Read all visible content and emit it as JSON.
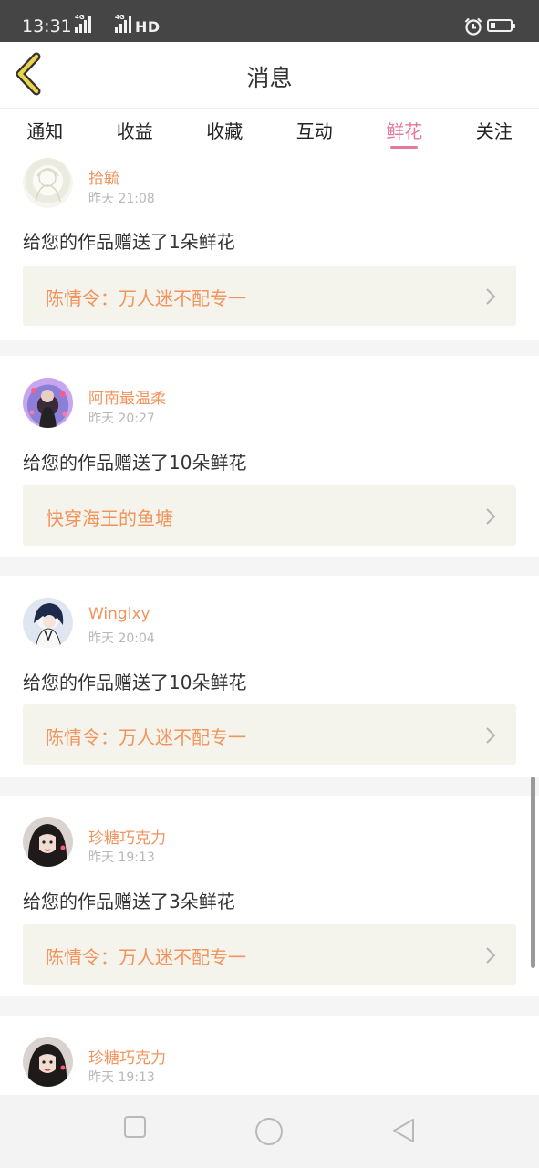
{
  "status_bar": {
    "time": "13:31",
    "signal_1": "4G",
    "signal_2": "4G",
    "hd_label": "HD",
    "battery_level": 0.25,
    "alarm_icon": "alarm-clock-icon"
  },
  "header": {
    "title": "消息",
    "back_icon": "chevron-left-icon"
  },
  "tabs": [
    {
      "label": "通知",
      "active": false
    },
    {
      "label": "收益",
      "active": false
    },
    {
      "label": "收藏",
      "active": false
    },
    {
      "label": "互动",
      "active": false
    },
    {
      "label": "鲜花",
      "active": true
    },
    {
      "label": "关注",
      "active": false
    }
  ],
  "feed": {
    "items": [
      {
        "user": "拾毓",
        "time": "昨天 21:08",
        "message": "给您的作品赠送了1朵鲜花",
        "work": "陈情令：万人迷不配专一"
      },
      {
        "user": "阿南最温柔",
        "time": "昨天 20:27",
        "message": "给您的作品赠送了10朵鲜花",
        "work": "快穿海王的鱼塘"
      },
      {
        "user": "Winglxy",
        "time": "昨天 20:04",
        "message": "给您的作品赠送了10朵鲜花",
        "work": "陈情令：万人迷不配专一"
      },
      {
        "user": "珍糖巧克力",
        "time": "昨天 19:13",
        "message": "给您的作品赠送了3朵鲜花",
        "work": "陈情令：万人迷不配专一"
      },
      {
        "user": "珍糖巧克力",
        "time": "昨天 19:13"
      }
    ]
  },
  "nav_bar": {
    "recents_icon": "square-icon",
    "home_icon": "circle-icon",
    "back_icon": "triangle-back-icon"
  },
  "colors": {
    "accent": "#e5789c",
    "username": "#f2935c",
    "work_bg": "#f4f4ec"
  }
}
